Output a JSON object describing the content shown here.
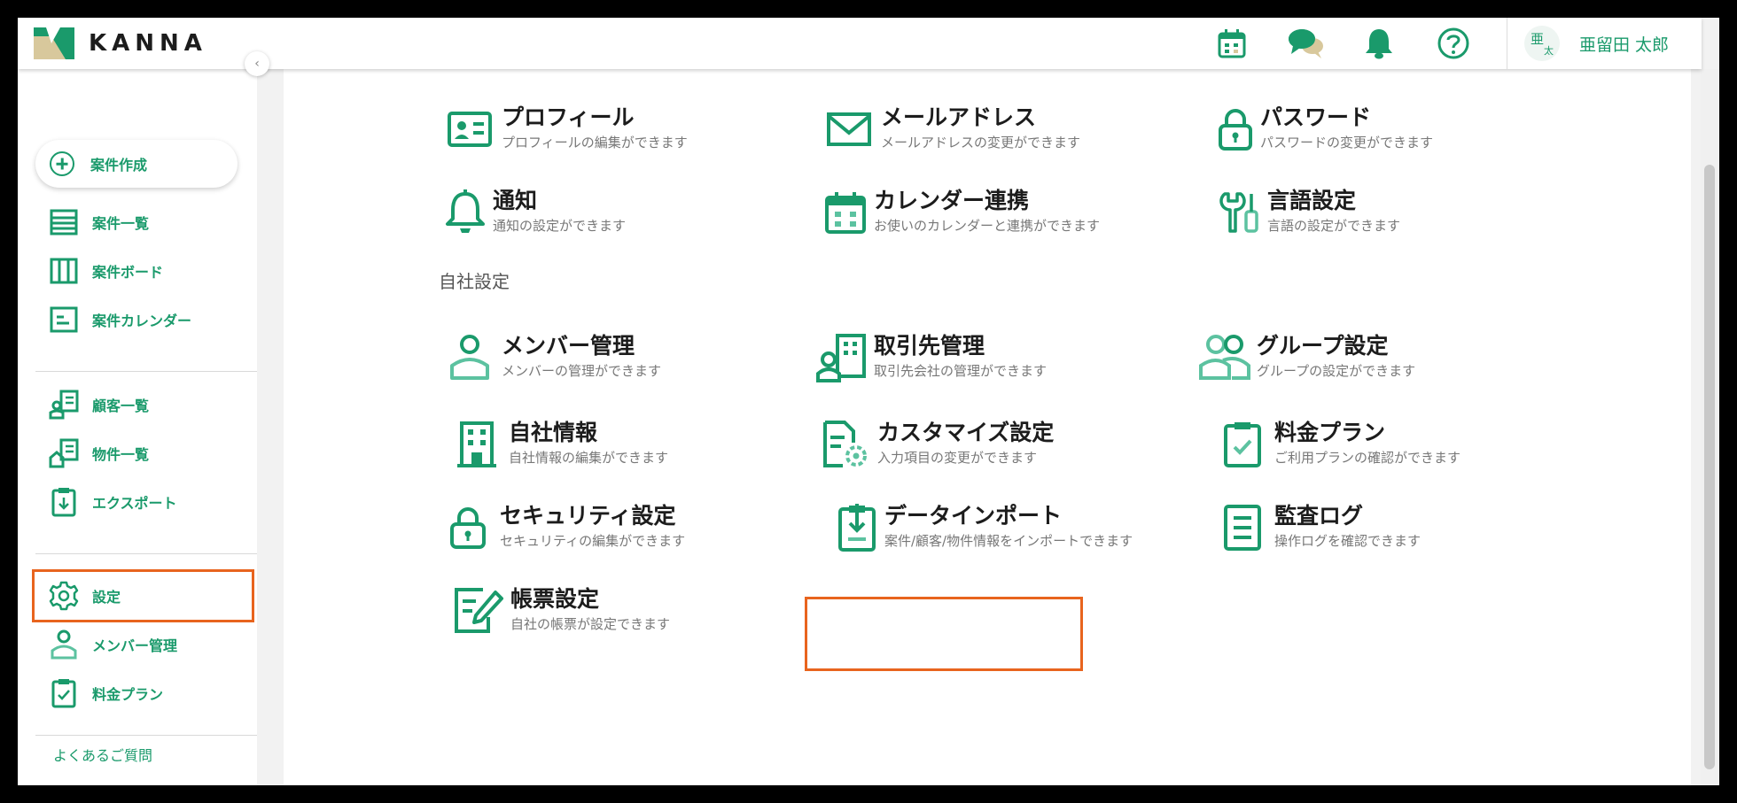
{
  "app": {
    "name": "KANNA"
  },
  "header": {
    "user_avatar_top": "亜",
    "user_avatar_bottom": "太",
    "user_name": "亜留田 太郎",
    "icons": [
      "calendar-icon",
      "chat-icon",
      "bell-icon",
      "help-icon"
    ]
  },
  "sidebar": {
    "create_label": "案件作成",
    "items": [
      {
        "label": "案件一覧",
        "icon": "list-icon"
      },
      {
        "label": "案件ボード",
        "icon": "board-icon"
      },
      {
        "label": "案件カレンダー",
        "icon": "calendar-icon"
      },
      {
        "label": "顧客一覧",
        "icon": "customer-icon"
      },
      {
        "label": "物件一覧",
        "icon": "property-icon"
      },
      {
        "label": "エクスポート",
        "icon": "export-icon"
      },
      {
        "label": "設定",
        "icon": "gear-icon"
      },
      {
        "label": "メンバー管理",
        "icon": "member-icon"
      },
      {
        "label": "料金プラン",
        "icon": "plan-icon"
      }
    ],
    "faq_label": "よくあるご質問"
  },
  "personal_cards": [
    {
      "title": "プロフィール",
      "sub": "プロフィールの編集ができます"
    },
    {
      "title": "メールアドレス",
      "sub": "メールアドレスの変更ができます"
    },
    {
      "title": "パスワード",
      "sub": "パスワードの変更ができます"
    },
    {
      "title": "通知",
      "sub": "通知の設定ができます"
    },
    {
      "title": "カレンダー連携",
      "sub": "お使いのカレンダーと連携ができます"
    },
    {
      "title": "言語設定",
      "sub": "言語の設定ができます"
    }
  ],
  "company_section_title": "自社設定",
  "company_cards": [
    {
      "title": "メンバー管理",
      "sub": "メンバーの管理ができます"
    },
    {
      "title": "取引先管理",
      "sub": "取引先会社の管理ができます"
    },
    {
      "title": "グループ設定",
      "sub": "グループの設定ができます"
    },
    {
      "title": "自社情報",
      "sub": "自社情報の編集ができます"
    },
    {
      "title": "カスタマイズ設定",
      "sub": "入力項目の変更ができます"
    },
    {
      "title": "料金プラン",
      "sub": "ご利用プランの確認ができます"
    },
    {
      "title": "セキュリティ設定",
      "sub": "セキュリティの編集ができます"
    },
    {
      "title": "データインポート",
      "sub": "案件/顧客/物件情報をインポートできます"
    },
    {
      "title": "監査ログ",
      "sub": "操作ログを確認できます"
    },
    {
      "title": "帳票設定",
      "sub": "自社の帳票が設定できます"
    }
  ],
  "colors": {
    "accent": "#1a9a6b",
    "highlight": "#e8641e"
  }
}
